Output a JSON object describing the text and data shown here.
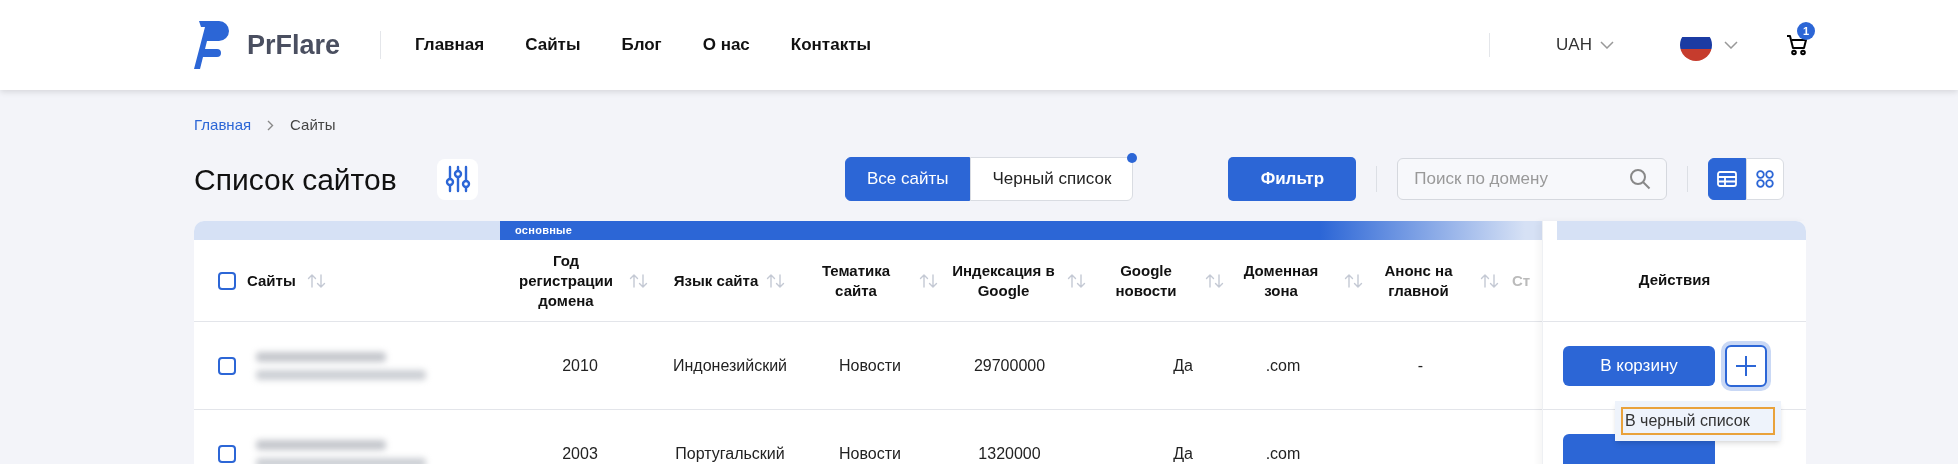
{
  "header": {
    "logo": "PrFlare",
    "nav": [
      {
        "label": "Главная"
      },
      {
        "label": "Сайты"
      },
      {
        "label": "Блог"
      },
      {
        "label": "О нас"
      },
      {
        "label": "Контакты"
      }
    ],
    "currency": "UAH",
    "cart_count": "1"
  },
  "breadcrumbs": [
    {
      "label": "Главная",
      "kind": "link"
    },
    {
      "label": "Сайты",
      "kind": "current"
    }
  ],
  "page_title": "Список сайтов",
  "tabs": [
    {
      "label": "Все сайты",
      "selected": true,
      "dot": false
    },
    {
      "label": "Черный список",
      "selected": false,
      "dot": true
    }
  ],
  "filter_button": "Фильтр",
  "search": {
    "placeholder": "Поиск по домену"
  },
  "view_modes": [
    {
      "kind": "table",
      "selected": true
    },
    {
      "kind": "grid",
      "selected": false
    }
  ],
  "table": {
    "group_label": "основные",
    "columns": [
      {
        "label": "Сайты",
        "sortable": true
      },
      {
        "label": "Год регистрации домена",
        "sortable": true
      },
      {
        "label": "Язык сайта",
        "sortable": true
      },
      {
        "label": "Тематика сайта",
        "sortable": true
      },
      {
        "label": "Индексация в Google",
        "sortable": true
      },
      {
        "label": "Google новости",
        "sortable": true
      },
      {
        "label": "Доменная зона",
        "sortable": true
      },
      {
        "label": "Анонс на главной",
        "sortable": true
      },
      {
        "label": "Ст",
        "sortable": false
      }
    ],
    "all_checked": false,
    "actions_label": "Действия",
    "rows": [
      {
        "checked": false,
        "cells": [
          "",
          "2010",
          "Индонезийский",
          "Новости",
          "29700000",
          "Да",
          ".com",
          "-"
        ],
        "cart_button": "В корзину",
        "menu_open": true
      },
      {
        "checked": false,
        "cells": [
          "",
          "2003",
          "Португальский",
          "Новости",
          "1320000",
          "Да",
          ".com",
          ""
        ],
        "cart_button": "",
        "menu_open": false
      }
    ],
    "menu_item": "В черный список"
  }
}
